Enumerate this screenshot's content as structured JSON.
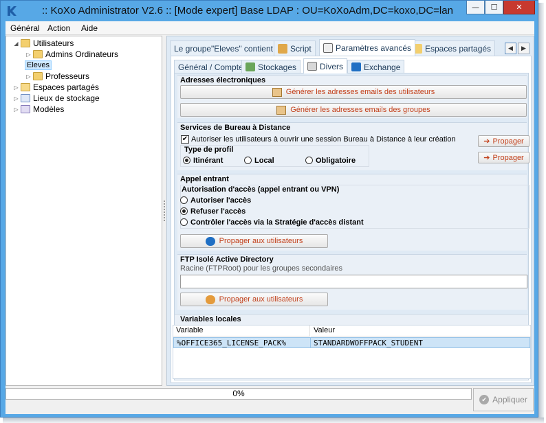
{
  "window": {
    "title": ":: KoXo Administrator V2.6 :: [Mode expert] Base LDAP : OU=KoXoAdm,DC=koxo,DC=lan",
    "minimize_glyph": "—",
    "maximize_glyph": "☐",
    "close_glyph": "✕",
    "accent": "#57a8e6"
  },
  "menu": {
    "items": [
      "Général",
      "Action",
      "Aide"
    ]
  },
  "tree": {
    "root": "Utilisateurs",
    "children": [
      "Admins Ordinateurs",
      "Eleves",
      "Professeurs"
    ],
    "selected": "Eleves",
    "others": [
      "Espaces partagés",
      "Lieux de stockage",
      "Modèles"
    ]
  },
  "tabs": {
    "items": [
      "Le groupe\"Eleves\" contient",
      "Script",
      "Paramètres avancés",
      "Espaces partagés"
    ],
    "active": "Paramètres avancés"
  },
  "subtabs": {
    "items": [
      "Général / Compte",
      "Stockages",
      "Divers",
      "Exchange"
    ],
    "active": "Divers"
  },
  "emails": {
    "title": "Adresses électroniques",
    "btn_users": "Générer les adresses emails des utilisateurs",
    "btn_groups": "Générer les adresses emails des groupes"
  },
  "rds": {
    "title": "Services de Bureau à Distance",
    "allow_label": "Autoriser les utilisateurs à ouvrir une session Bureau à Distance à leur création",
    "allow_checked": true,
    "propagate_label": "Propager",
    "profile_title": "Type de profil",
    "profile_options": [
      "Itinérant",
      "Local",
      "Obligatoire"
    ],
    "profile_selected": "Itinérant"
  },
  "dialin": {
    "title": "Appel entrant",
    "group_title": "Autorisation d'accès (appel entrant ou VPN)",
    "options": [
      "Autoriser l'accès",
      "Refuser l'accès",
      "Contrôler l'accès via la Stratégie d'accès distant"
    ],
    "selected": "Refuser l'accès",
    "propagate_label": "Propager aux utilisateurs"
  },
  "ftp": {
    "title": "FTP Isolé Active Directory",
    "field_label": "Racine (FTPRoot) pour les groupes secondaires",
    "field_value": "",
    "propagate_label": "Propager aux utilisateurs"
  },
  "vars": {
    "title": "Variables locales",
    "columns": [
      "Variable",
      "Valeur"
    ],
    "rows": [
      {
        "name": "%OFFICE365_LICENSE_PACK%",
        "value": "STANDARDWOFFPACK_STUDENT"
      }
    ]
  },
  "footer": {
    "progress_value": 0,
    "progress_text": "0%",
    "apply_label": "Appliquer"
  }
}
